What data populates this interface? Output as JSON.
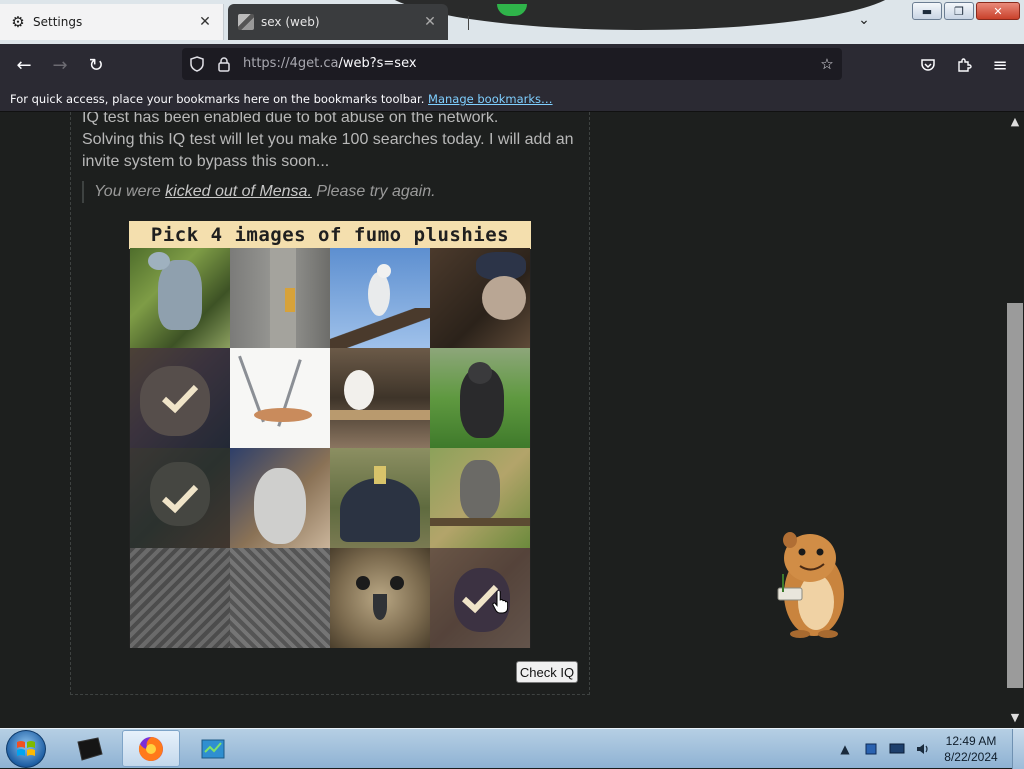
{
  "browser": {
    "tabs": [
      {
        "label": "Settings",
        "icon": "gear-icon",
        "active": false
      },
      {
        "label": "sex (web)",
        "icon": "site-favicon",
        "active": true
      }
    ],
    "url": {
      "host": "https://4get.ca",
      "path": "/web?s=sex"
    },
    "bookmarks_bar": {
      "message": "For quick access, place your bookmarks here on the bookmarks toolbar.",
      "link": "Manage bookmarks…"
    }
  },
  "page": {
    "notice_line1": "IQ test has been enabled due to bot abuse on the network.",
    "notice_line2": "Solving this IQ test will let you make 100 searches today. I will add an invite system to bypass this soon...",
    "quote_prefix": "You were ",
    "quote_link": "kicked out of Mensa.",
    "quote_suffix": " Please try again.",
    "captcha": {
      "title": "Pick 4 images of fumo plushies",
      "cells": [
        {
          "name": "heron-grass",
          "selected": false
        },
        {
          "name": "bird-behind-post",
          "selected": false
        },
        {
          "name": "egret-on-branch",
          "selected": false
        },
        {
          "name": "dark-bird-closeup",
          "selected": false
        },
        {
          "name": "fumo-plush-1",
          "selected": true
        },
        {
          "name": "heron-sketch",
          "selected": false
        },
        {
          "name": "snowy-owl-shelf",
          "selected": false
        },
        {
          "name": "eagle-on-grass",
          "selected": false
        },
        {
          "name": "fumo-plush-2",
          "selected": true
        },
        {
          "name": "bird-wing-closeup",
          "selected": false
        },
        {
          "name": "vulture-back",
          "selected": false
        },
        {
          "name": "harpy-eagle-branch",
          "selected": false
        },
        {
          "name": "owl-feathers-1",
          "selected": false
        },
        {
          "name": "owl-feathers-2",
          "selected": false
        },
        {
          "name": "hawk-face",
          "selected": false
        },
        {
          "name": "fumo-plush-3",
          "selected": true
        }
      ]
    },
    "check_button": "Check IQ"
  },
  "taskbar": {
    "time": "12:49 AM",
    "date": "8/22/2024"
  }
}
